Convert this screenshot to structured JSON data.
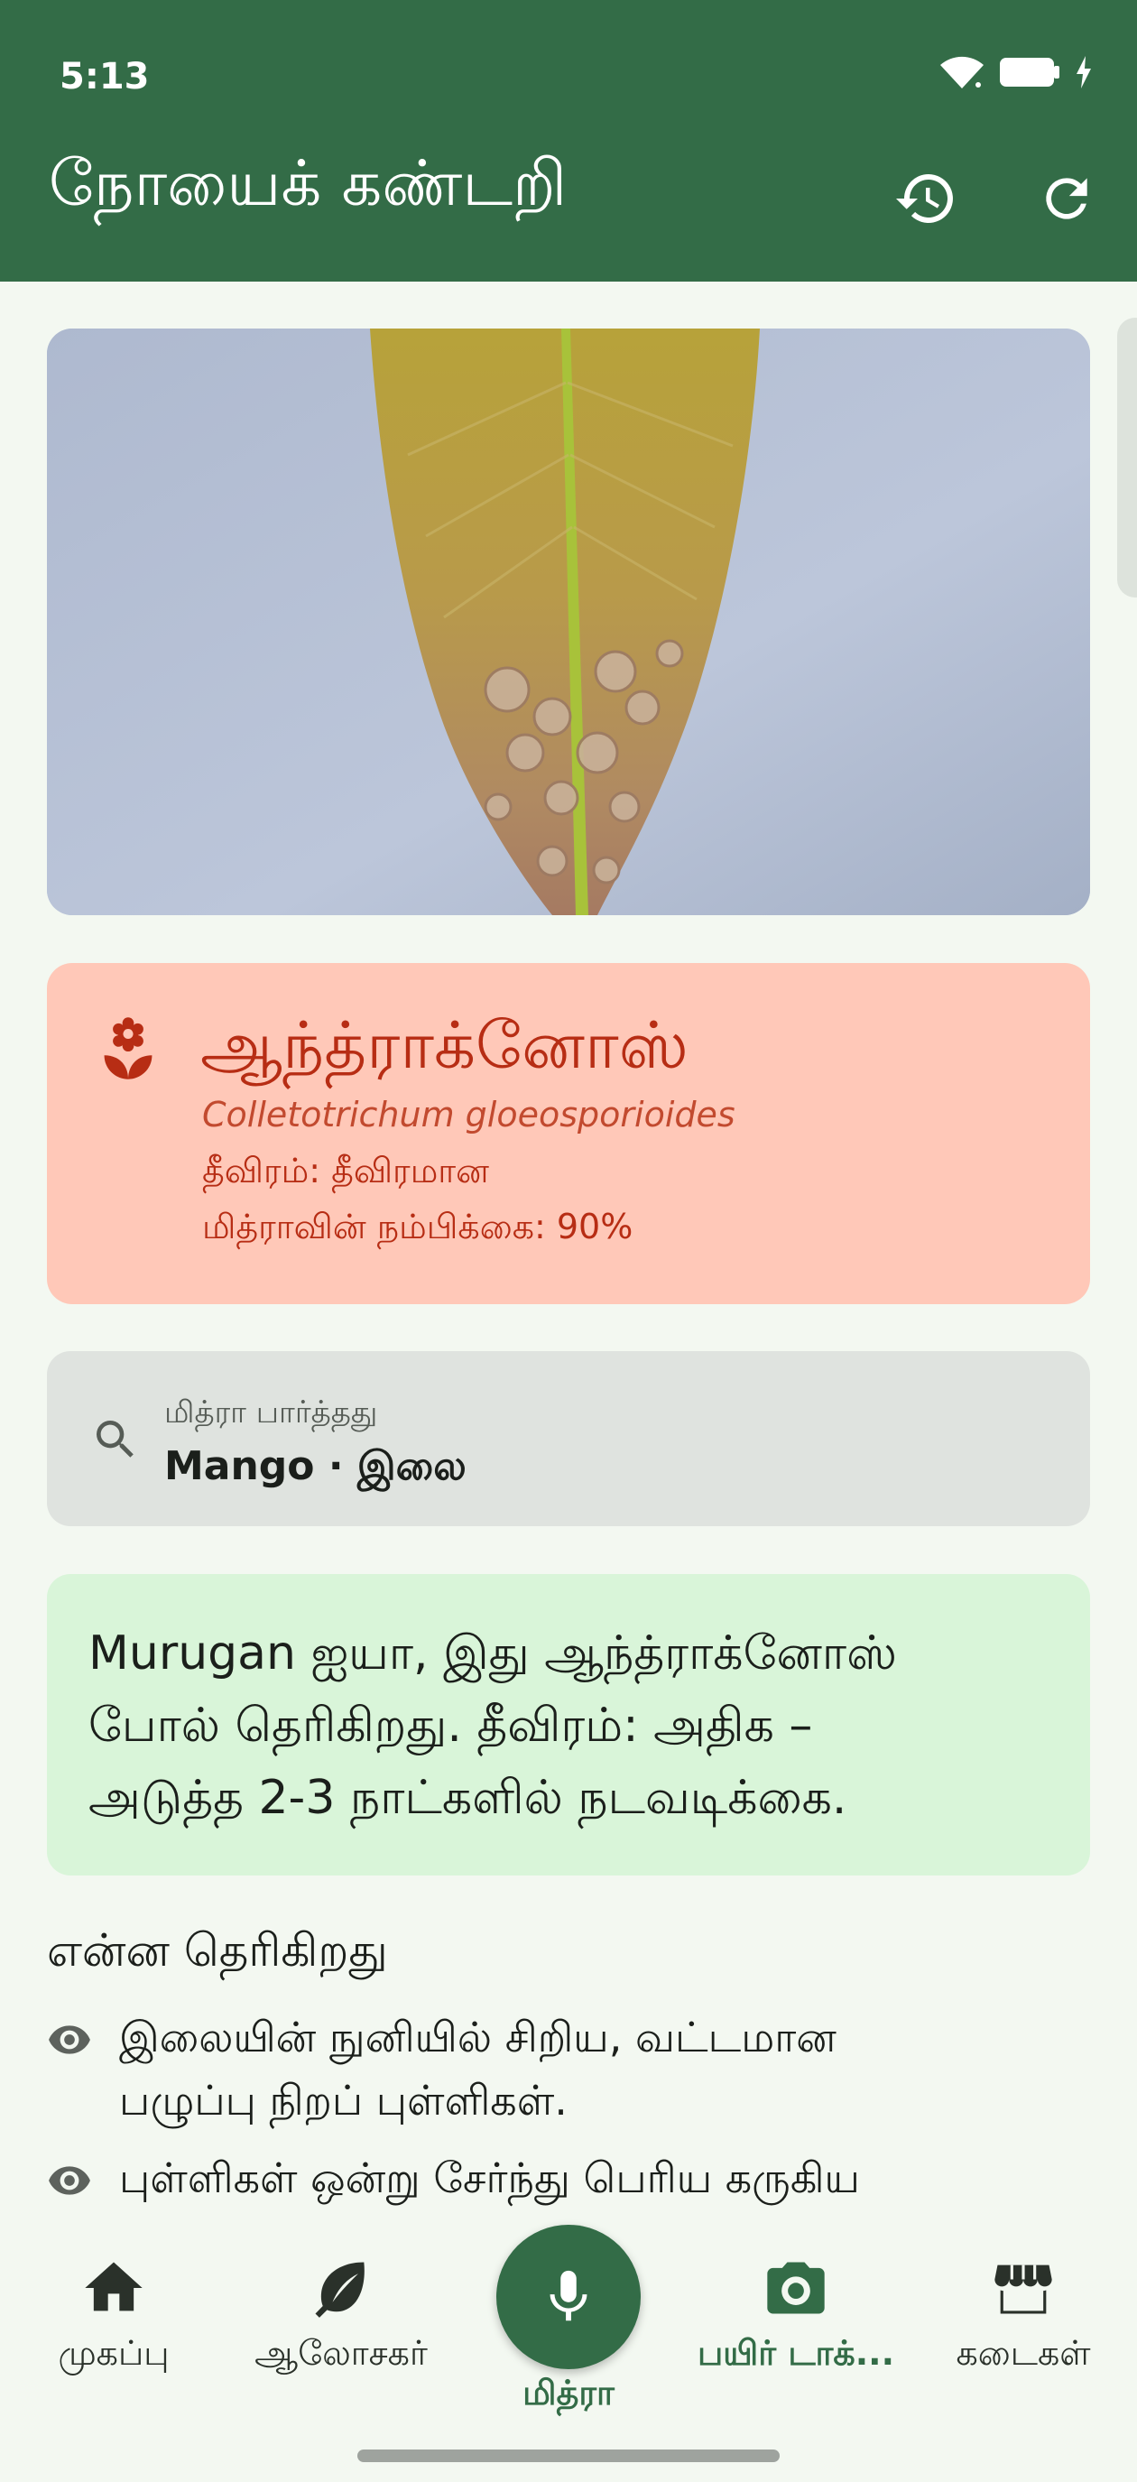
{
  "status_bar": {
    "time": "5:13"
  },
  "app_bar": {
    "title": "நோயைக் கண்டறி",
    "history_icon": "history-icon",
    "refresh_icon": "refresh-icon"
  },
  "diagnosis": {
    "name": "ஆந்த்ராக்னோஸ்",
    "scientific_name": "Colletotrichum gloeosporioides",
    "severity": "தீவிரம்: தீவிரமான",
    "confidence": "மித்ராவின் நம்பிக்கை: 90%",
    "icon": "disease-flower-icon",
    "color": "#b72d14"
  },
  "detected": {
    "label": "மித்ரா பார்த்தது",
    "value": "Mango · இலை"
  },
  "message": {
    "lines": [
      "Murugan ஐயா, இது ஆந்த்ராக்னோஸ்",
      "போல் தெரிகிறது. தீவிரம்: அதிக –",
      "அடுத்த 2-3 நாட்களில் நடவடிக்கை."
    ]
  },
  "observations": {
    "title": "என்ன தெரிகிறது",
    "items": [
      {
        "line1": "இலையின் நுனியில் சிறிய, வட்டமான",
        "line2": "பழுப்பு நிறப் புள்ளிகள்."
      },
      {
        "line1": "புள்ளிகள் ஒன்று சேர்ந்து பெரிய கருகிய",
        "line2": ""
      }
    ]
  },
  "bottom_nav": {
    "items": [
      {
        "label": "முகப்பு",
        "icon": "home-icon"
      },
      {
        "label": "ஆலோசகர்",
        "icon": "leaf-icon"
      },
      {
        "label": "மித்ரா",
        "icon": "mic-icon"
      },
      {
        "label": "பயிர் டாக்...",
        "icon": "camera-icon"
      },
      {
        "label": "கடைகள்",
        "icon": "store-icon"
      }
    ],
    "active": "பயிர் டாக்..."
  },
  "colors": {
    "primary": "#336c47",
    "background": "#f3f8f1",
    "diagnosis_bg": "#ffc8b8",
    "message_bg": "#d9f5d9"
  }
}
